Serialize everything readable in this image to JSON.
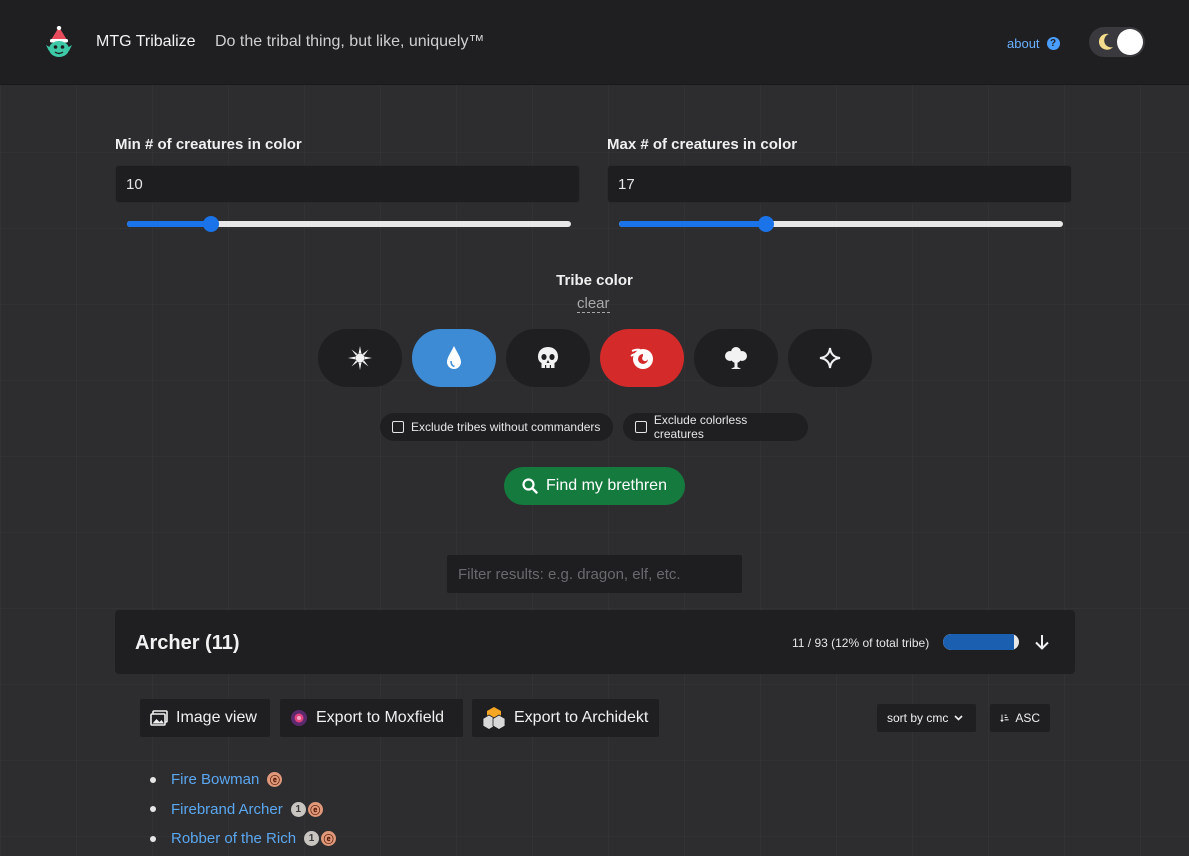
{
  "header": {
    "title": "MTG Tribalize",
    "tagline": "Do the tribal thing, but like, uniquely™",
    "about_label": "about"
  },
  "filters": {
    "min_label": "Min # of creatures in color",
    "min_value": "10",
    "min_slider_fraction": 0.19,
    "max_label": "Max # of creatures in color",
    "max_value": "17",
    "max_slider_fraction": 0.33,
    "tribe_color_label": "Tribe color",
    "clear_label": "clear",
    "colors": [
      {
        "name": "white",
        "icon": "sun-icon",
        "selected": false
      },
      {
        "name": "blue",
        "icon": "water-drop-icon",
        "selected": true,
        "color": "#3d8bd4"
      },
      {
        "name": "black",
        "icon": "skull-icon",
        "selected": false
      },
      {
        "name": "red",
        "icon": "fireball-icon",
        "selected": true,
        "color": "#d42a2a"
      },
      {
        "name": "green",
        "icon": "tree-icon",
        "selected": false
      },
      {
        "name": "colorless",
        "icon": "diamond-icon",
        "selected": false
      }
    ],
    "exclude_commanders_label": "Exclude tribes without commanders",
    "exclude_colorless_label": "Exclude colorless creatures",
    "find_button_label": "Find my brethren"
  },
  "results": {
    "filter_placeholder": "Filter results: e.g. dragon, elf, etc.",
    "tribe": {
      "name": "Archer (11)",
      "stats": "11 / 93 (12% of total tribe)",
      "progress_fraction": 0.93
    },
    "toolbar": {
      "image_view_label": "Image view",
      "moxfield_label": "Export to Moxfield",
      "archidekt_label": "Export to Archidekt",
      "sort_label": "sort by cmc",
      "order_label": "ASC"
    },
    "cards": [
      {
        "name": "Fire Bowman",
        "mana": [
          "R"
        ]
      },
      {
        "name": "Firebrand Archer",
        "mana": [
          "1",
          "R"
        ]
      },
      {
        "name": "Robber of the Rich",
        "mana": [
          "1",
          "R"
        ]
      }
    ]
  }
}
